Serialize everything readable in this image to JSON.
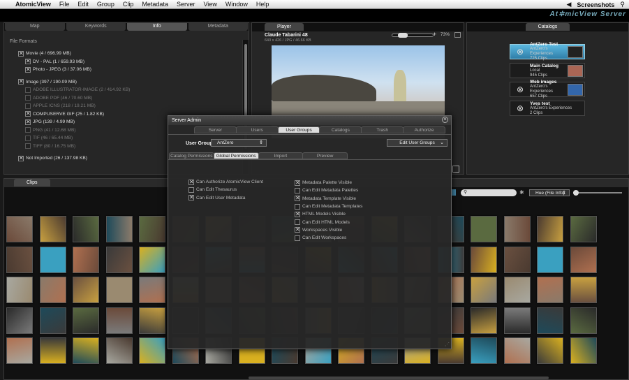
{
  "menubar": {
    "app_name": "AtomicView",
    "items": [
      "File",
      "Edit",
      "Group",
      "Clip",
      "Metadata",
      "Server",
      "View",
      "Window",
      "Help"
    ],
    "right_label": "Screenshots",
    "search_icon": "magnifier-icon",
    "volume_icon": "speaker-icon"
  },
  "brand": {
    "left": "At",
    "mid": "✲",
    "right": "micView Server"
  },
  "info_panel": {
    "tabs": [
      "Map",
      "Keywords",
      "Info",
      "Metadata"
    ],
    "active_tab": "Info",
    "heading": "File Formats",
    "formats": [
      {
        "label": "Movie (4 / 696.99 MB)",
        "checked": true,
        "indent": 0,
        "dim": false
      },
      {
        "label": "DV - PAL (1 / 659.93 MB)",
        "checked": true,
        "indent": 1,
        "dim": false
      },
      {
        "label": "Photo - JPEG (3 / 37.06 MB)",
        "checked": true,
        "indent": 1,
        "dim": false
      },
      {
        "label": "Image (397 / 190.09 MB)",
        "checked": true,
        "indent": 0,
        "dim": false
      },
      {
        "label": "ADOBE ILLUSTRATOR-IMAGE (2 / 414.92 KB)",
        "checked": false,
        "indent": 1,
        "dim": true
      },
      {
        "label": "ADOBE PDF (46 / 70.60 MB)",
        "checked": false,
        "indent": 1,
        "dim": true
      },
      {
        "label": "APPLE ICNS (218 / 19.21 MB)",
        "checked": false,
        "indent": 1,
        "dim": true
      },
      {
        "label": "COMPUSERVE GIF (25 / 1.82 KB)",
        "checked": true,
        "indent": 1,
        "dim": false
      },
      {
        "label": "JPG (139 / 4.99 MB)",
        "checked": true,
        "indent": 1,
        "dim": false
      },
      {
        "label": "PNG (41 / 12.68 MB)",
        "checked": false,
        "indent": 1,
        "dim": true
      },
      {
        "label": "TIF (46 / 65.44 MB)",
        "checked": false,
        "indent": 1,
        "dim": true
      },
      {
        "label": "TIFF (80 / 16.75 MB)",
        "checked": false,
        "indent": 1,
        "dim": true
      },
      {
        "label": "Not Imported (26 / 137.98 KB)",
        "checked": true,
        "indent": 0,
        "dim": false
      }
    ]
  },
  "player": {
    "title": "Player",
    "clip_name": "Claude Tabarini 48",
    "clip_meta": "640 x 426 / JPG / 46.66 KB",
    "zoom": "73%"
  },
  "catalogs": {
    "title": "Catalogs",
    "items": [
      {
        "name": "AntZero Test",
        "owner": "AntZero's Experiences",
        "count": "725 Clips",
        "selected": true
      },
      {
        "name": "Main Catalog",
        "owner": "Local",
        "count": "945 Clips",
        "selected": false
      },
      {
        "name": "Web images",
        "owner": "AntZero's Experiences",
        "count": "657 Clips",
        "selected": false
      },
      {
        "name": "Yves test",
        "owner": "AntZero's Experiences",
        "count": "2 Clips",
        "selected": false
      }
    ]
  },
  "clips": {
    "title": "Clips",
    "sort_label": "Hue (File Info)"
  },
  "dialog": {
    "title": "Server Admin",
    "tabs": [
      "Server",
      "Users",
      "User Groups",
      "Catalogs",
      "Trash",
      "Authorize"
    ],
    "active_tab": "User Groups",
    "user_group_label": "User Group",
    "user_group_value": "AntZero",
    "edit_groups_label": "Edit User Groups",
    "subtabs": [
      "Catalog Permissions",
      "Global Permissions",
      "Import",
      "Preview"
    ],
    "active_subtab": "Global Permissions",
    "perms_left": [
      {
        "label": "Can Authorize AtomicView Client",
        "checked": true
      },
      {
        "label": "Can Edit Thesaurus",
        "checked": false
      },
      {
        "label": "Can Edit User Metadata",
        "checked": true
      }
    ],
    "perms_right": [
      {
        "label": "Metadata Palette Visible",
        "checked": true
      },
      {
        "label": "Can Edit Metadata Palettes",
        "checked": false
      },
      {
        "label": "Metadata Template Visible",
        "checked": true
      },
      {
        "label": "Can Edit Metadata Templates",
        "checked": false
      },
      {
        "label": "HTML Models Visible",
        "checked": true
      },
      {
        "label": "Can Edit HTML Models",
        "checked": false
      },
      {
        "label": "Workspaces Visible",
        "checked": true
      },
      {
        "label": "Can Edit Workspaces",
        "checked": false
      }
    ]
  }
}
